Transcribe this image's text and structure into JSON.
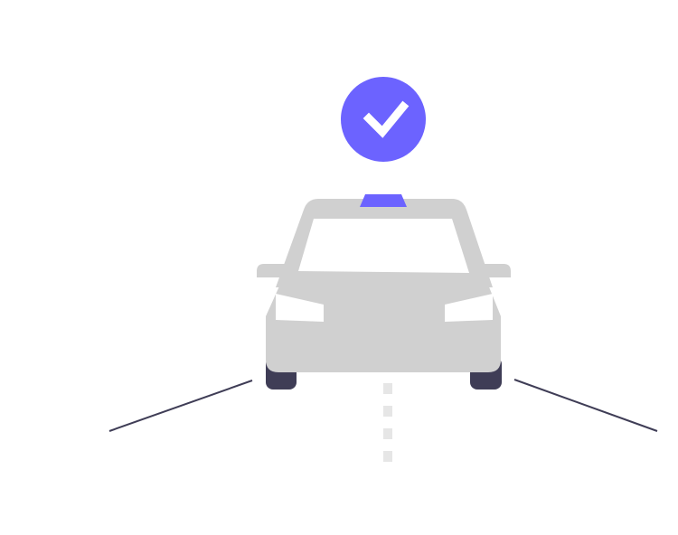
{
  "illustration": {
    "icons": {
      "badge": "check-circle-icon",
      "vehicle": "taxi-car-icon",
      "road": "road-lane-icon"
    },
    "colors": {
      "accent": "#6C63FF",
      "car_body": "#D0D0D0",
      "window": "#FFFFFF",
      "tires": "#3F3D56",
      "road_lines": "#3F3D56",
      "lane_dashes": "#E6E6E6",
      "checkmark": "#FFFFFF"
    }
  }
}
